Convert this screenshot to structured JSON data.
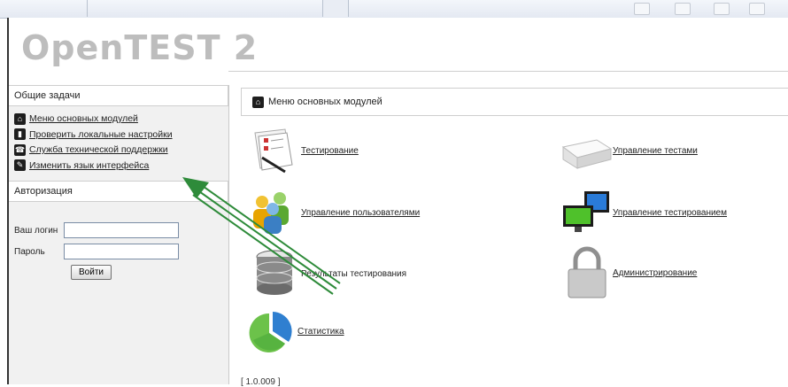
{
  "app": {
    "title": "OpenTEST 2"
  },
  "left": {
    "tasks_title": "Общие задачи",
    "tasks": [
      {
        "label": "Меню основных модулей",
        "icon": "home-icon"
      },
      {
        "label": "Проверить локальные настройки",
        "icon": "chart-icon"
      },
      {
        "label": "Служба технической поддержки",
        "icon": "phone-icon"
      },
      {
        "label": "Изменить язык интерфейса",
        "icon": "wrench-icon"
      }
    ],
    "auth_title": "Авторизация",
    "login_label": "Ваш логин",
    "password_label": "Пароль",
    "login_value": "",
    "password_value": "",
    "login_button": "Войти"
  },
  "main": {
    "header": "Меню основных модулей",
    "modules": [
      {
        "label": "Тестирование",
        "icon": "test-sheet-icon"
      },
      {
        "label": "Управление тестами",
        "icon": "paper-stack-icon"
      },
      {
        "label": "Управление пользователями",
        "icon": "users-icon"
      },
      {
        "label": "Управление тестированием",
        "icon": "monitors-icon"
      },
      {
        "label": "Результаты тестирования",
        "icon": "database-icon"
      },
      {
        "label": "Администрирование",
        "icon": "padlock-icon"
      },
      {
        "label": "Статистика",
        "icon": "pie-chart-icon"
      }
    ],
    "footer": "[ 1.0.009 ]"
  },
  "colors": {
    "arrow": "#2e8b3a",
    "logo": "#bdbdbd"
  }
}
